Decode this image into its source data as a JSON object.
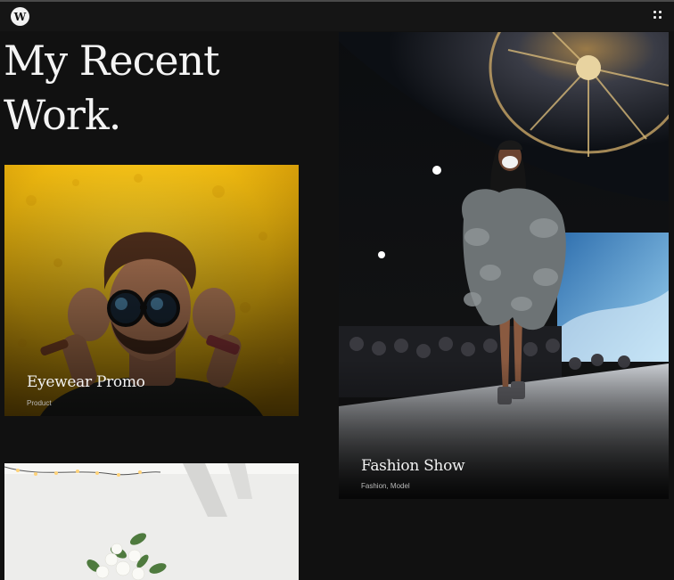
{
  "header": {
    "logo_letter": "W",
    "logo_icon": "site-logo-icon",
    "menu_icon": "grid-menu-icon"
  },
  "hero": {
    "line1": "My Recent",
    "line2": "Work."
  },
  "projects": [
    {
      "title": "Eyewear Promo",
      "tags": "Product"
    },
    {
      "title": "Fashion Show",
      "tags": "Fashion, Model"
    },
    {
      "title": "",
      "tags": ""
    }
  ],
  "colors": {
    "background": "#111111",
    "topbar": "#151515",
    "accent_yellow": "#f2c21a"
  }
}
